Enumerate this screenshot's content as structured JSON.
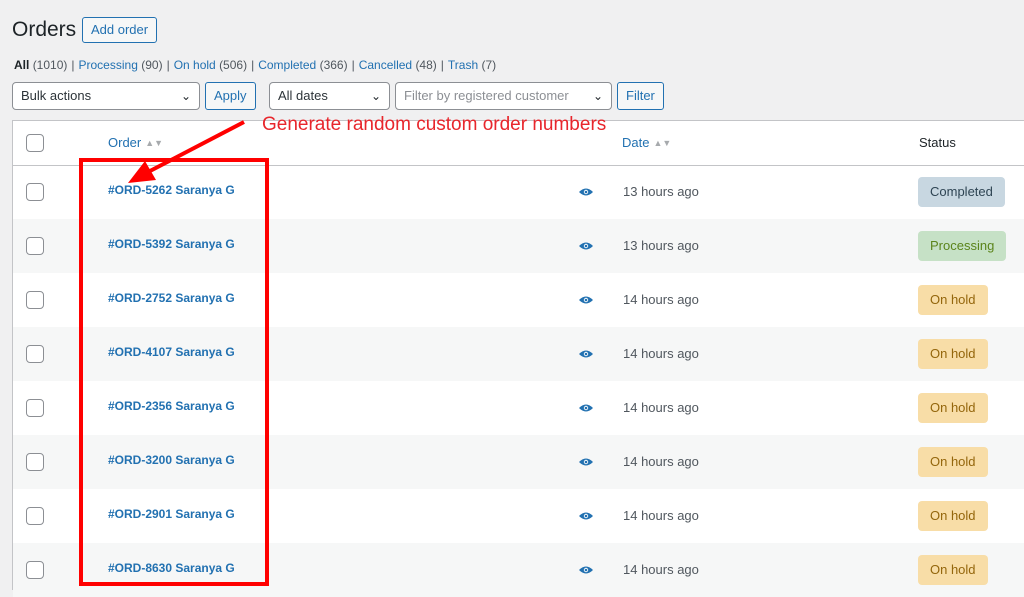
{
  "header": {
    "title": "Orders",
    "add_order_label": "Add order"
  },
  "views": [
    {
      "label": "All",
      "count": "(1010)",
      "current": true
    },
    {
      "label": "Processing",
      "count": "(90)"
    },
    {
      "label": "On hold",
      "count": "(506)"
    },
    {
      "label": "Completed",
      "count": "(366)"
    },
    {
      "label": "Cancelled",
      "count": "(48)"
    },
    {
      "label": "Trash",
      "count": "(7)"
    }
  ],
  "filters": {
    "bulk_actions": "Bulk actions",
    "apply_label": "Apply",
    "dates": "All dates",
    "customer_placeholder": "Filter by registered customer",
    "filter_label": "Filter"
  },
  "table": {
    "columns": {
      "order": "Order",
      "date": "Date",
      "status": "Status"
    },
    "rows": [
      {
        "order": "#ORD-5262 Saranya G",
        "date": "13 hours ago",
        "status": "Completed",
        "status_key": "completed"
      },
      {
        "order": "#ORD-5392 Saranya G",
        "date": "13 hours ago",
        "status": "Processing",
        "status_key": "processing"
      },
      {
        "order": "#ORD-2752 Saranya G",
        "date": "14 hours ago",
        "status": "On hold",
        "status_key": "on-hold"
      },
      {
        "order": "#ORD-4107 Saranya G",
        "date": "14 hours ago",
        "status": "On hold",
        "status_key": "on-hold"
      },
      {
        "order": "#ORD-2356 Saranya G",
        "date": "14 hours ago",
        "status": "On hold",
        "status_key": "on-hold"
      },
      {
        "order": "#ORD-3200 Saranya G",
        "date": "14 hours ago",
        "status": "On hold",
        "status_key": "on-hold"
      },
      {
        "order": "#ORD-2901 Saranya G",
        "date": "14 hours ago",
        "status": "On hold",
        "status_key": "on-hold"
      },
      {
        "order": "#ORD-8630 Saranya G",
        "date": "14 hours ago",
        "status": "On hold",
        "status_key": "on-hold"
      }
    ]
  },
  "annotation": {
    "text": "Generate random custom order numbers",
    "color": "#ff0000"
  },
  "colors": {
    "link": "#2271b1",
    "completed": "#c8d7e1",
    "processing": "#c6e1c6",
    "on_hold": "#f8dda7"
  }
}
